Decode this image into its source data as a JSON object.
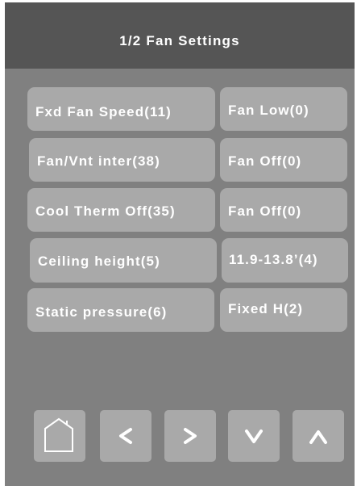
{
  "header": {
    "title": "1/2 Fan Settings"
  },
  "settings": [
    {
      "name": "Fxd Fan Speed(11)",
      "value": "Fan Low(0)"
    },
    {
      "name": "Fan/Vnt inter(38)",
      "value": "Fan Off(0)"
    },
    {
      "name": "Cool Therm Off(35)",
      "value": "Fan Off(0)"
    },
    {
      "name": "Ceiling height(5)",
      "value": "11.9-13.8’(4)"
    },
    {
      "name": "Static pressure(6)",
      "value": "Fixed H(2)"
    }
  ],
  "nav": {
    "home_icon": "home-icon",
    "left_icon": "chevron-left-icon",
    "right_icon": "chevron-right-icon",
    "down_icon": "chevron-down-icon",
    "up_icon": "chevron-up-icon"
  },
  "colors": {
    "background": "#808080",
    "header": "#555555",
    "button": "#a9a9a9",
    "text": "#ffffff"
  }
}
